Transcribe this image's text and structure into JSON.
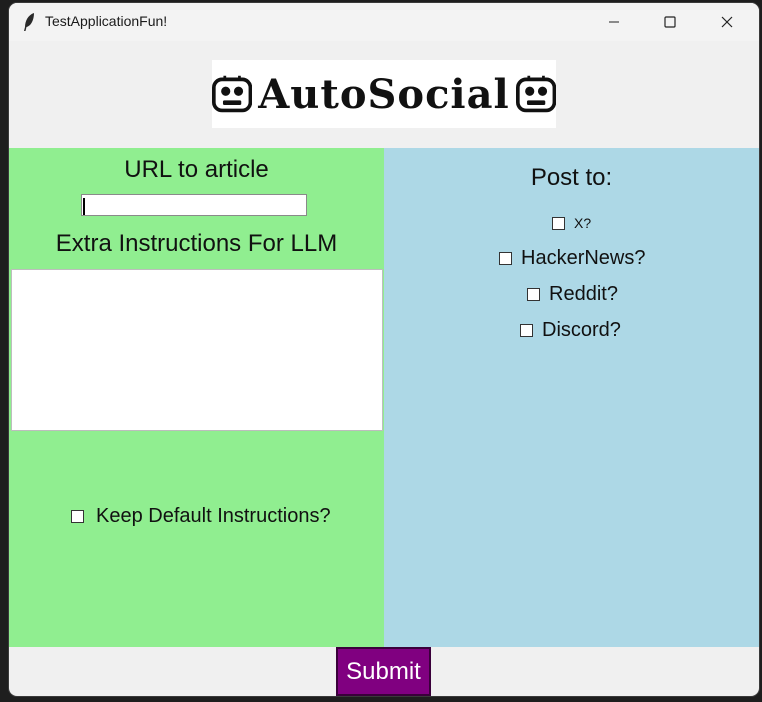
{
  "window": {
    "title": "TestApplicationFun!"
  },
  "logo": {
    "text": "AutoSocial"
  },
  "left_panel": {
    "url_label": "URL to article",
    "url_value": "",
    "extra_label": "Extra Instructions For LLM",
    "instructions_value": "",
    "keep_default_label": "Keep Default Instructions?",
    "keep_default_checked": false
  },
  "right_panel": {
    "post_to_label": "Post to:",
    "options": [
      {
        "label": "X?",
        "checked": false
      },
      {
        "label": "HackerNews?",
        "checked": false
      },
      {
        "label": "Reddit?",
        "checked": false
      },
      {
        "label": "Discord?",
        "checked": false
      }
    ]
  },
  "submit": {
    "label": "Submit"
  },
  "colors": {
    "left_panel_bg": "#90ee90",
    "right_panel_bg": "#add8e6",
    "submit_bg": "#800080"
  }
}
